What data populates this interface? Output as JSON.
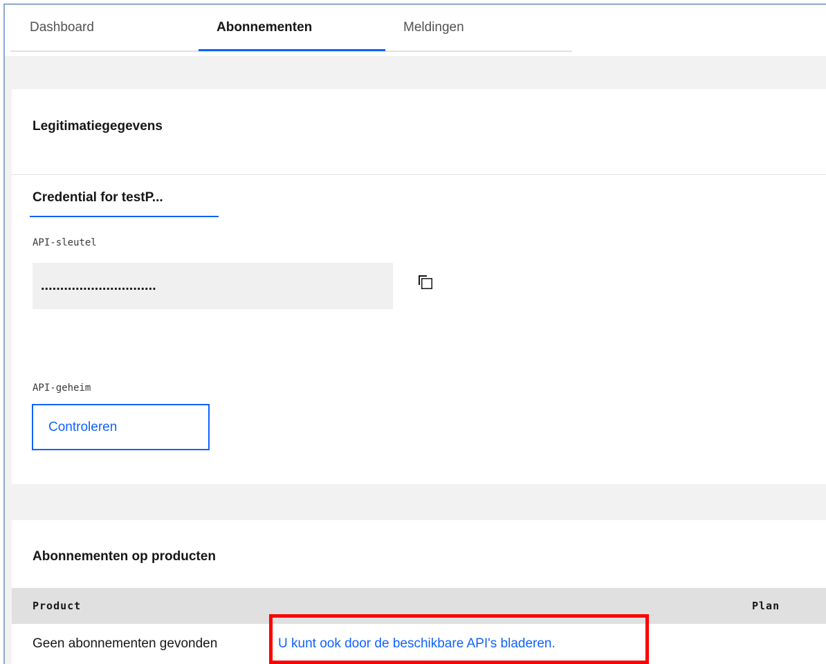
{
  "tabs": [
    {
      "label": "Dashboard"
    },
    {
      "label": "Abonnementen"
    },
    {
      "label": "Meldingen"
    }
  ],
  "credentials": {
    "title": "Legitimatiegegevens",
    "credential_tab": "Credential for testP...",
    "api_key_label": "API-sleutel",
    "api_key_value": "..............................",
    "api_secret_label": "API-geheim",
    "verify_button": "Controleren"
  },
  "subscriptions": {
    "title": "Abonnementen op producten",
    "columns": [
      "Product",
      "Plan"
    ],
    "empty_text": "Geen abonnementen gevonden",
    "browse_link": "U kunt ook door de beschikbare API's bladeren."
  },
  "colors": {
    "accent": "#0f62fe",
    "highlight": "#ff0000"
  }
}
